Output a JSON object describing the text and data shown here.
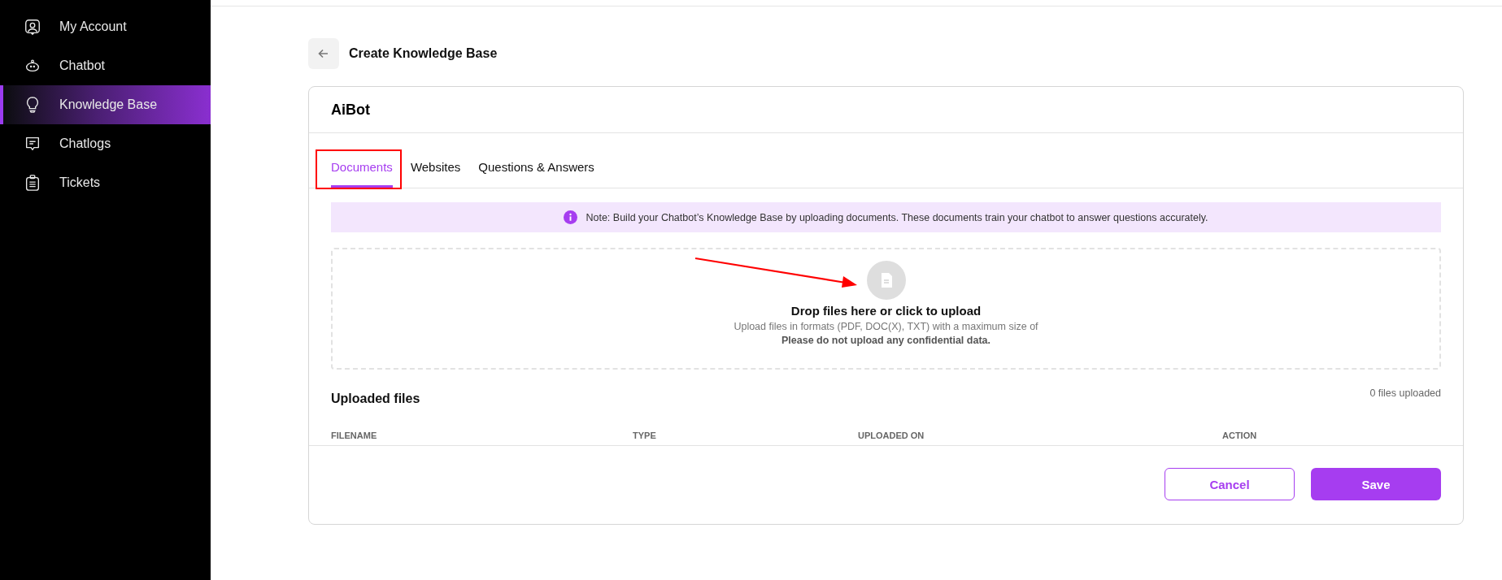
{
  "sidebar": {
    "items": [
      {
        "label": "My Account",
        "kind": "account",
        "selected": false
      },
      {
        "label": "Chatbot",
        "kind": "bot",
        "selected": false
      },
      {
        "label": "Knowledge Base",
        "kind": "bulb",
        "selected": true
      },
      {
        "label": "Chatlogs",
        "kind": "chat",
        "selected": false
      },
      {
        "label": "Tickets",
        "kind": "ticket",
        "selected": false
      }
    ]
  },
  "page": {
    "title": "Create Knowledge Base"
  },
  "card": {
    "title": "AiBot",
    "tabs": [
      {
        "label": "Documents",
        "selected": true
      },
      {
        "label": "Websites",
        "selected": false
      },
      {
        "label": "Questions & Answers",
        "selected": false
      }
    ],
    "note": "Note: Build your Chatbot’s Knowledge Base by uploading documents. These documents train your chatbot to answer questions accurately.",
    "dropzone": {
      "title": "Drop files here or click to upload",
      "hint": "Upload files in formats (PDF, DOC(X), TXT) with a maximum size of",
      "warning": "Please do not upload any confidential data."
    },
    "uploaded": {
      "title": "Uploaded files",
      "count": "0 files uploaded",
      "columns": [
        "FILENAME",
        "TYPE",
        "UPLOADED ON",
        "ACTION"
      ]
    },
    "buttons": [
      {
        "label": "Cancel",
        "kind": "secondary"
      },
      {
        "label": "Save",
        "kind": "primary"
      }
    ]
  }
}
